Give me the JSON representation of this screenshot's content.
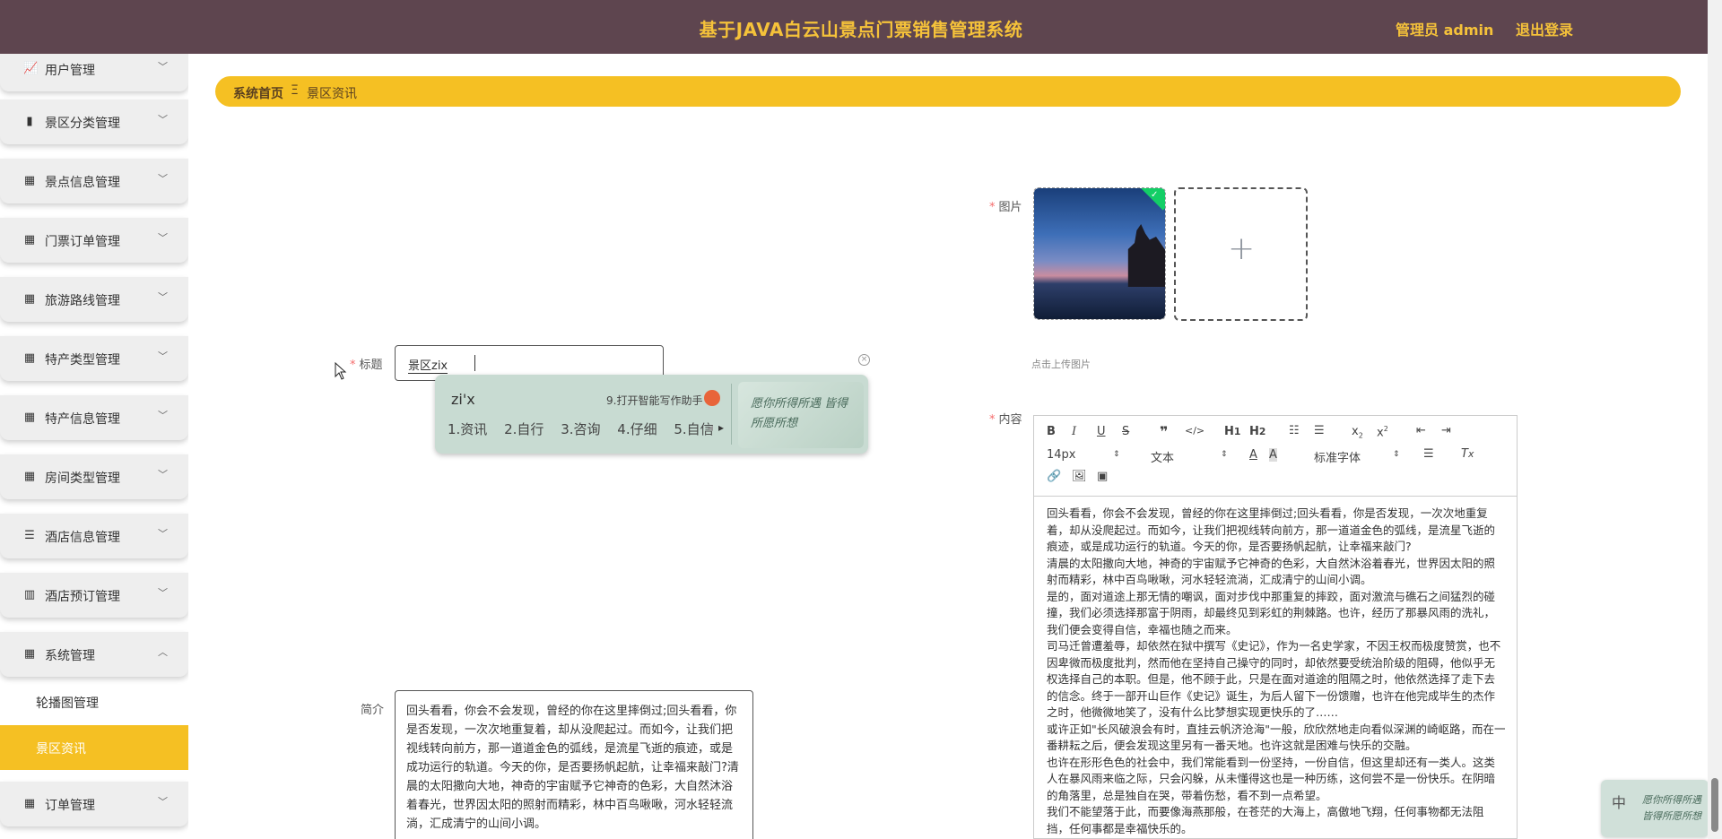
{
  "header": {
    "title": "基于JAVA白云山景点门票销售管理系统",
    "admin_label": "管理员 admin",
    "logout_label": "退出登录"
  },
  "sidebar": {
    "items": [
      {
        "label": "用户管理",
        "icon": "chart-line-icon"
      },
      {
        "label": "景区分类管理",
        "icon": "bar-chart-icon"
      },
      {
        "label": "景点信息管理",
        "icon": "grid-icon"
      },
      {
        "label": "门票订单管理",
        "icon": "grid-icon"
      },
      {
        "label": "旅游路线管理",
        "icon": "grid-icon"
      },
      {
        "label": "特产类型管理",
        "icon": "grid-icon"
      },
      {
        "label": "特产信息管理",
        "icon": "grid-icon"
      },
      {
        "label": "房间类型管理",
        "icon": "grid-icon"
      },
      {
        "label": "酒店信息管理",
        "icon": "sliders-icon"
      },
      {
        "label": "酒店预订管理",
        "icon": "building-icon"
      },
      {
        "label": "系统管理",
        "icon": "grid-icon"
      },
      {
        "label": "订单管理",
        "icon": "grid-icon"
      }
    ],
    "sub_items": [
      {
        "label": "轮播图管理"
      },
      {
        "label": "景区资讯"
      }
    ]
  },
  "breadcrumb": {
    "home": "系统首页",
    "separator": "Ξ",
    "current": "景区资讯"
  },
  "form": {
    "title_label": "标题",
    "title_value": "景区zix",
    "intro_label": "简介",
    "intro_value": "回头看看，你会不会发现，曾经的你在这里摔倒过;回头看看，你是否发现，一次次地重复着，却从没爬起过。而如今，让我们把视线转向前方，那一道道金色的弧线，是流星飞逝的痕迹，或是成功运行的轨道。今天的你，是否要扬帆起航，让幸福来敲门?清晨的太阳撒向大地，神奇的宇宙赋予它神奇的色彩，大自然沐浴着春光，世界因太阳的照射而精彩，林中百鸟啾啾，河水轻轻流淌，汇成清宁的山间小调。",
    "image_label": "图片",
    "upload_tip": "点击上传图片",
    "content_label": "内容"
  },
  "ime": {
    "pinyin": "zi'x",
    "helper": "9.打开智能写作助手",
    "candidates": [
      "1.资讯",
      "2.自行",
      "3.咨询",
      "4.仔细",
      "5.自信"
    ],
    "skin_text": "愿你所得所遇 皆得所愿所想",
    "mini_zh": "中"
  },
  "editor": {
    "font_size": "14px",
    "text_type": "文本",
    "font_family": "标准字体",
    "paragraphs": [
      "回头看看，你会不会发现，曾经的你在这里摔倒过;回头看看，你是否发现，一次次地重复着，却从没爬起过。而如今，让我们把视线转向前方，那一道道金色的弧线，是流星飞逝的痕迹，或是成功运行的轨道。今天的你，是否要扬帆起航，让幸福来敲门?",
      "清晨的太阳撒向大地，神奇的宇宙赋予它神奇的色彩，大自然沐浴着春光，世界因太阳的照射而精彩，林中百鸟啾啾，河水轻轻流淌，汇成清宁的山间小调。",
      "是的，面对道途上那无情的嘲讽，面对步伐中那重复的摔跤，面对激流与礁石之间猛烈的碰撞，我们必须选择那富于阴雨，却最终见到彩虹的荆棘路。也许，经历了那暴风雨的洗礼，我们便会变得自信，幸福也随之而来。",
      "司马迁曾遭羞辱，却依然在狱中撰写《史记》，作为一名史学家，不因王权而极度赞赏，也不因卑微而极度批判，然而他在坚持自己操守的同时，却依然要受统治阶级的阻碍，他似乎无权选择自己的本职。但是，他不顾于此，只是在面对道途的阻隔之时，他依然选择了走下去的信念。终于一部开山巨作《史记》诞生，为后人留下一份馈赠，也许在他完成毕生的杰作之时，他微微地笑了，没有什么比梦想实现更快乐的了……",
      "或许正如\"长风破浪会有时，直挂云帆济沧海\"一般，欣欣然地走向看似深渊的崎岖路，而在一番耕耘之后，便会发现这里另有一番天地。也许这就是困难与快乐的交融。",
      "也许在形形色色的社会中，我们常能看到一份坚持，一份自信，但这里却还有一类人。这类人在暴风雨来临之际，只会闪躲，从未懂得这也是一种历练，这何尝不是一份快乐。在阴暗的角落里，总是独自在哭，带着伤愁，看不到一点希望。",
      "我们不能望落于此，而要像海燕那般，在苍茫的大海上，高傲地飞翔，任何事物都无法阻挡，任何事都是幸福快乐的。"
    ]
  }
}
